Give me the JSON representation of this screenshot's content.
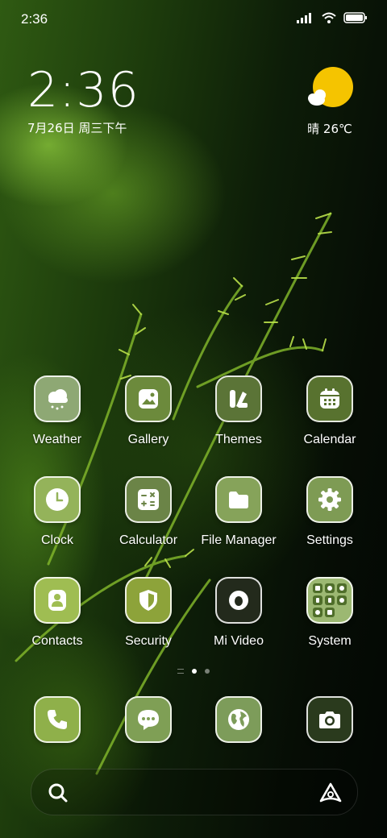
{
  "status_bar": {
    "time": "2:36"
  },
  "clock_widget": {
    "time": "2:36",
    "date": "7月26日 周三下午"
  },
  "weather_widget": {
    "condition_temp": "晴 26℃"
  },
  "apps": [
    {
      "label": "Weather",
      "icon": "weather-cloud-icon",
      "color": "#8ea874"
    },
    {
      "label": "Gallery",
      "icon": "gallery-photo-icon",
      "color": "#6c8a3c"
    },
    {
      "label": "Themes",
      "icon": "themes-brush-icon",
      "color": "#5b7437"
    },
    {
      "label": "Calendar",
      "icon": "calendar-icon",
      "color": "#58722f"
    },
    {
      "label": "Clock",
      "icon": "clock-icon",
      "color": "#94b35a"
    },
    {
      "label": "Calculator",
      "icon": "calculator-icon",
      "color": "#6b8447"
    },
    {
      "label": "File Manager",
      "icon": "folder-icon",
      "color": "#86a35a"
    },
    {
      "label": "Settings",
      "icon": "gear-icon",
      "color": "#7e9b54"
    },
    {
      "label": "Contacts",
      "icon": "contact-person-icon",
      "color": "#9fbd52"
    },
    {
      "label": "Security",
      "icon": "shield-icon",
      "color": "#8da33a"
    },
    {
      "label": "Mi Video",
      "icon": "video-play-icon",
      "color": "#232a1c"
    },
    {
      "label": "System",
      "icon": "folder-grid-icon",
      "color": "#9cb872"
    }
  ],
  "dock": [
    {
      "name": "phone",
      "icon": "phone-icon",
      "color": "#8fb04a"
    },
    {
      "name": "messages",
      "icon": "chat-bubble-icon",
      "color": "#7f9f55"
    },
    {
      "name": "browser",
      "icon": "globe-icon",
      "color": "#7d9c5a"
    },
    {
      "name": "camera",
      "icon": "camera-icon",
      "color": "#2a3a1d"
    }
  ],
  "pages": {
    "count": 2,
    "current": 1
  }
}
